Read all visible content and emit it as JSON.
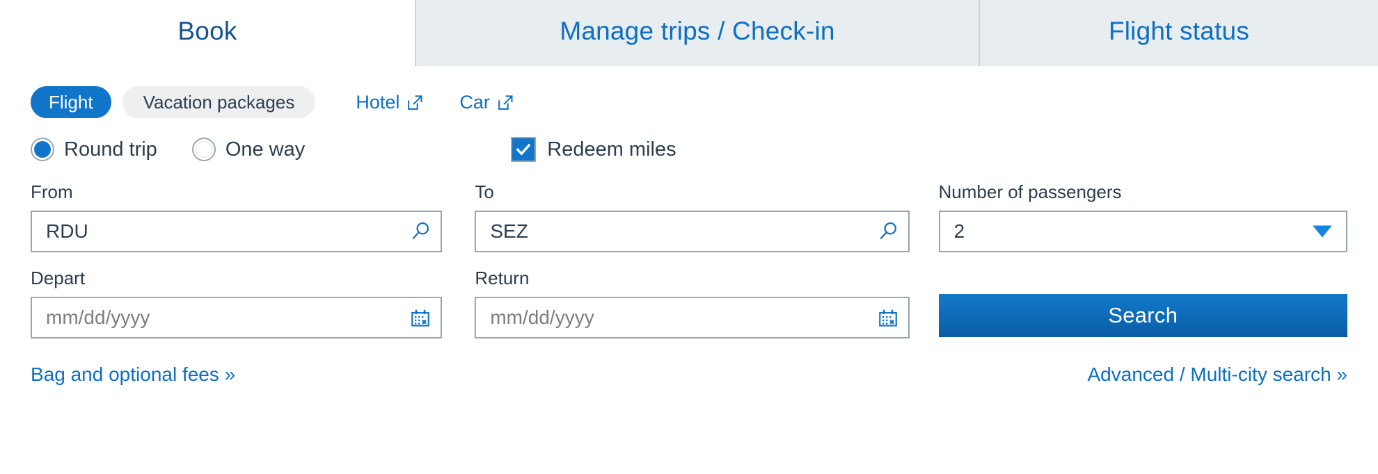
{
  "tabs": [
    {
      "label": "Book",
      "active": true
    },
    {
      "label": "Manage trips / Check-in",
      "active": false
    },
    {
      "label": "Flight status",
      "active": false
    }
  ],
  "product_options": {
    "flight_pill": "Flight",
    "vacation_pill": "Vacation packages",
    "hotel_link": "Hotel",
    "car_link": "Car",
    "hotel_icon": "external-link-icon",
    "car_icon": "external-link-icon"
  },
  "trip_type": {
    "round_trip_label": "Round trip",
    "one_way_label": "One way",
    "selected": "Round trip"
  },
  "redeem": {
    "label": "Redeem miles",
    "checked": true,
    "check_glyph": "checkmark-icon"
  },
  "fields": {
    "from": {
      "label": "From",
      "value": "RDU",
      "placeholder": "",
      "icon": "search-icon"
    },
    "to": {
      "label": "To",
      "value": "SEZ",
      "placeholder": "",
      "icon": "search-icon"
    },
    "passengers": {
      "label": "Number of passengers",
      "value": "2",
      "icon": "chevron-down-icon"
    },
    "depart": {
      "label": "Depart",
      "value": "",
      "placeholder": "mm/dd/yyyy",
      "icon": "calendar-icon"
    },
    "return": {
      "label": "Return",
      "value": "",
      "placeholder": "mm/dd/yyyy",
      "icon": "calendar-icon"
    }
  },
  "search_button": "Search",
  "footer": {
    "bag_fees": "Bag and optional fees »",
    "advanced_search": "Advanced / Multi-city search »"
  },
  "colors": {
    "brand_blue": "#0d6fc4",
    "pill_blue": "#1175c9",
    "active_tab_text": "#15558d",
    "tab_bg": "#e8edef",
    "text_dark": "#2b3e50",
    "border_gray": "#97a5ad",
    "placeholder_gray": "#7d7d7d"
  }
}
